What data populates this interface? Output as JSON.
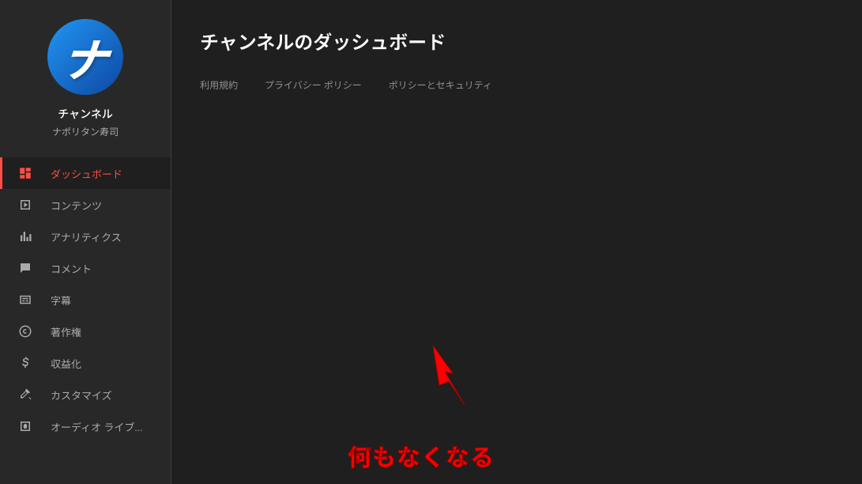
{
  "sidebar": {
    "channel_label": "チャンネル",
    "channel_name": "ナポリタン寿司",
    "avatar_letter": "ナ",
    "items": [
      {
        "label": "ダッシュボード",
        "icon": "dashboard-icon",
        "active": true
      },
      {
        "label": "コンテンツ",
        "icon": "content-icon",
        "active": false
      },
      {
        "label": "アナリティクス",
        "icon": "analytics-icon",
        "active": false
      },
      {
        "label": "コメント",
        "icon": "comment-icon",
        "active": false
      },
      {
        "label": "字幕",
        "icon": "subtitle-icon",
        "active": false
      },
      {
        "label": "著作権",
        "icon": "copyright-icon",
        "active": false
      },
      {
        "label": "収益化",
        "icon": "monetize-icon",
        "active": false
      },
      {
        "label": "カスタマイズ",
        "icon": "customize-icon",
        "active": false
      },
      {
        "label": "オーディオ ライブ...",
        "icon": "audio-icon",
        "active": false
      }
    ]
  },
  "main": {
    "title": "チャンネルのダッシュボード",
    "footer_links": [
      "利用規約",
      "プライバシー ポリシー",
      "ポリシーとセキュリティ"
    ]
  },
  "annotation": {
    "text": "何もなくなる"
  }
}
